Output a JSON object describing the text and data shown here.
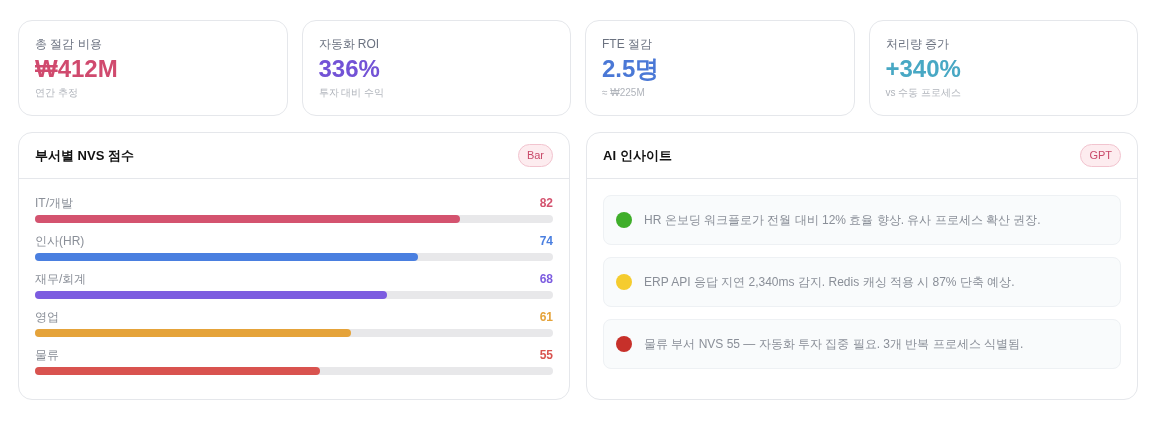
{
  "kpis": [
    {
      "label": "총 절감 비용",
      "value": "₩412M",
      "sub": "연간 추정",
      "color": "#d04a6e"
    },
    {
      "label": "자동화 ROI",
      "value": "336%",
      "sub": "투자 대비 수익",
      "color": "#7353d6"
    },
    {
      "label": "FTE 절감",
      "value": "2.5명",
      "sub": "≈ ₩225M",
      "color": "#4a78d6"
    },
    {
      "label": "처리량 증가",
      "value": "+340%",
      "sub": "vs 수동 프로세스",
      "color": "#48a8c4"
    }
  ],
  "nvs_panel": {
    "title": "부서별 NVS 점수",
    "badge": "Bar",
    "rows": [
      {
        "label": "IT/개발",
        "value": "82",
        "level": 0.82,
        "color": "#d4536f"
      },
      {
        "label": "인사(HR)",
        "value": "74",
        "level": 0.74,
        "color": "#4a7fe0"
      },
      {
        "label": "재무/회계",
        "value": "68",
        "level": 0.68,
        "color": "#7c5ce0"
      },
      {
        "label": "영업",
        "value": "61",
        "level": 0.61,
        "color": "#e5a33a"
      },
      {
        "label": "물류",
        "value": "55",
        "level": 0.55,
        "color": "#d9534f"
      }
    ]
  },
  "insights_panel": {
    "title": "AI 인사이트",
    "badge": "GPT",
    "items": [
      {
        "text": "HR 온보딩 워크플로가 전월 대비 12% 효율 향상. 유사 프로세스 확산 권장.",
        "color": "#3fae2a"
      },
      {
        "text": "ERP API 응답 지연 2,340ms 감지. Redis 캐싱 적용 시 87% 단축 예상.",
        "color": "#f5cc2e"
      },
      {
        "text": "물류 부서 NVS 55 — 자동화 투자 집중 필요. 3개 반복 프로세스 식별됨.",
        "color": "#c7302a"
      }
    ]
  }
}
